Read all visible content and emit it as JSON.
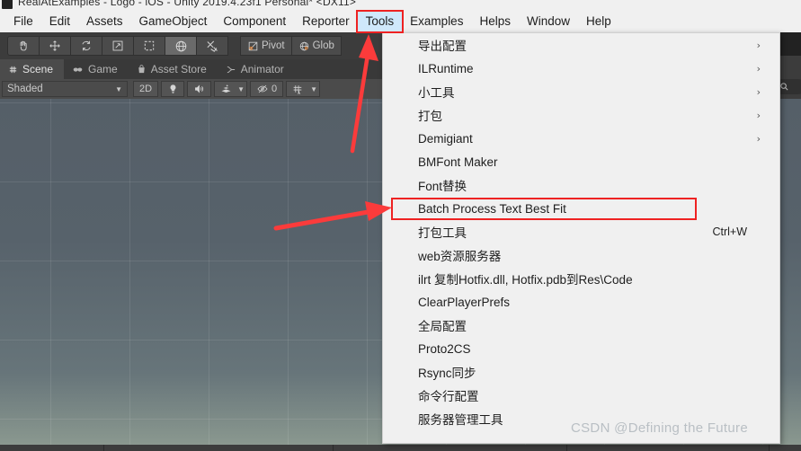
{
  "titlebar": {
    "text": "RealAtExamples - Logo - iOS - Unity 2019.4.23f1 Personal* <DX11>"
  },
  "menubar": {
    "items": [
      {
        "label": "File",
        "active": false
      },
      {
        "label": "Edit",
        "active": false
      },
      {
        "label": "Assets",
        "active": false
      },
      {
        "label": "GameObject",
        "active": false
      },
      {
        "label": "Component",
        "active": false
      },
      {
        "label": "Reporter",
        "active": false
      },
      {
        "label": "Tools",
        "active": true
      },
      {
        "label": "Examples",
        "active": false
      },
      {
        "label": "Helps",
        "active": false
      },
      {
        "label": "Window",
        "active": false
      },
      {
        "label": "Help",
        "active": false
      }
    ]
  },
  "toolbar": {
    "tools": [
      "hand-tool",
      "move-tool",
      "rotate-tool",
      "scale-tool",
      "rect-tool",
      "transform-tool",
      "custom-tool"
    ],
    "active_tool_index": 5,
    "pivot_label": "Pivot",
    "handle_label": "Glob"
  },
  "view_tabs": [
    {
      "label": "Scene",
      "icon": "grid-icon",
      "selected": true
    },
    {
      "label": "Game",
      "icon": "gamepad-icon",
      "selected": false
    },
    {
      "label": "Asset Store",
      "icon": "store-bag-icon",
      "selected": false
    },
    {
      "label": "Animator",
      "icon": "animator-icon",
      "selected": false
    }
  ],
  "scene_toolbar": {
    "draw_mode": "Shaded",
    "two_d_label": "2D",
    "lighting_icon": "lightbulb-icon",
    "audio_icon": "speaker-icon",
    "fx_icon": "effects-icon",
    "visibility_count": "0",
    "gizmos_icon": "gizmos-icon"
  },
  "hierarchy": {
    "search_placeholder": ""
  },
  "dropdown": {
    "title": "Tools",
    "items": [
      {
        "label": "导出配置",
        "submenu": true,
        "shortcut": "",
        "highlighted": false
      },
      {
        "label": "ILRuntime",
        "submenu": true,
        "shortcut": "",
        "highlighted": false
      },
      {
        "label": "小工具",
        "submenu": true,
        "shortcut": "",
        "highlighted": false
      },
      {
        "label": "打包",
        "submenu": true,
        "shortcut": "",
        "highlighted": false
      },
      {
        "label": "Demigiant",
        "submenu": true,
        "shortcut": "",
        "highlighted": false
      },
      {
        "label": "BMFont Maker",
        "submenu": false,
        "shortcut": "",
        "highlighted": false
      },
      {
        "label": "Font替换",
        "submenu": false,
        "shortcut": "",
        "highlighted": false
      },
      {
        "label": "Batch Process Text Best Fit",
        "submenu": false,
        "shortcut": "",
        "highlighted": true
      },
      {
        "label": "打包工具",
        "submenu": false,
        "shortcut": "Ctrl+W",
        "highlighted": false
      },
      {
        "label": "web资源服务器",
        "submenu": false,
        "shortcut": "",
        "highlighted": false
      },
      {
        "label": "ilrt 复制Hotfix.dll, Hotfix.pdb到Res\\Code",
        "submenu": false,
        "shortcut": "",
        "highlighted": false
      },
      {
        "label": "ClearPlayerPrefs",
        "submenu": false,
        "shortcut": "",
        "highlighted": false
      },
      {
        "label": "全局配置",
        "submenu": false,
        "shortcut": "",
        "highlighted": false
      },
      {
        "label": "Proto2CS",
        "submenu": false,
        "shortcut": "",
        "highlighted": false
      },
      {
        "label": "Rsync同步",
        "submenu": false,
        "shortcut": "",
        "highlighted": false
      },
      {
        "label": "命令行配置",
        "submenu": false,
        "shortcut": "",
        "highlighted": false
      },
      {
        "label": "服务器管理工具",
        "submenu": false,
        "shortcut": "",
        "highlighted": false
      }
    ],
    "submenu_glyph": "›"
  },
  "annotations": {
    "arrow_color": "#fb3b3b",
    "highlight_color": "#ee2222",
    "menu_highlight_color": "#cfe8fb"
  },
  "watermark": {
    "text": "CSDN @Defining the Future"
  }
}
